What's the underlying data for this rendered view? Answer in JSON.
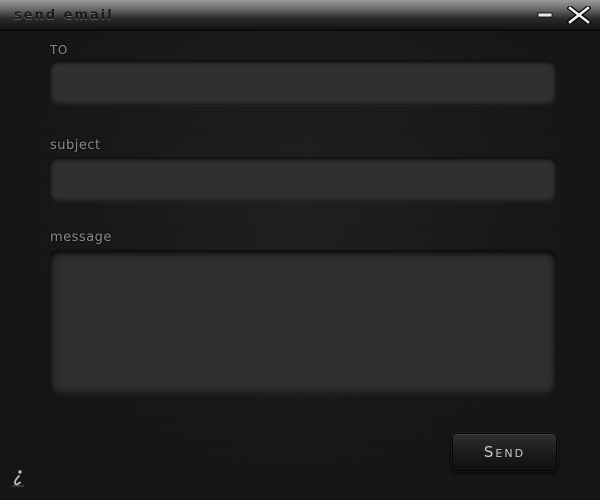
{
  "window": {
    "title": "send email",
    "minimize_icon": "minimize-icon",
    "close_icon": "close-icon"
  },
  "form": {
    "to_label": "TO",
    "to_value": "",
    "to_placeholder": "",
    "subject_label": "subject",
    "subject_value": "",
    "subject_placeholder": "",
    "message_label": "message",
    "message_value": "",
    "message_placeholder": ""
  },
  "actions": {
    "send_label": "Send"
  },
  "footer": {
    "info_icon": "info-icon"
  },
  "colors": {
    "background": "#151515",
    "title_bar_top": "#9c9c9c",
    "title_bar_bottom": "#111111",
    "field_bg": "#303030",
    "label_text": "#8a8a8a",
    "button_text": "#c8c8c8"
  }
}
